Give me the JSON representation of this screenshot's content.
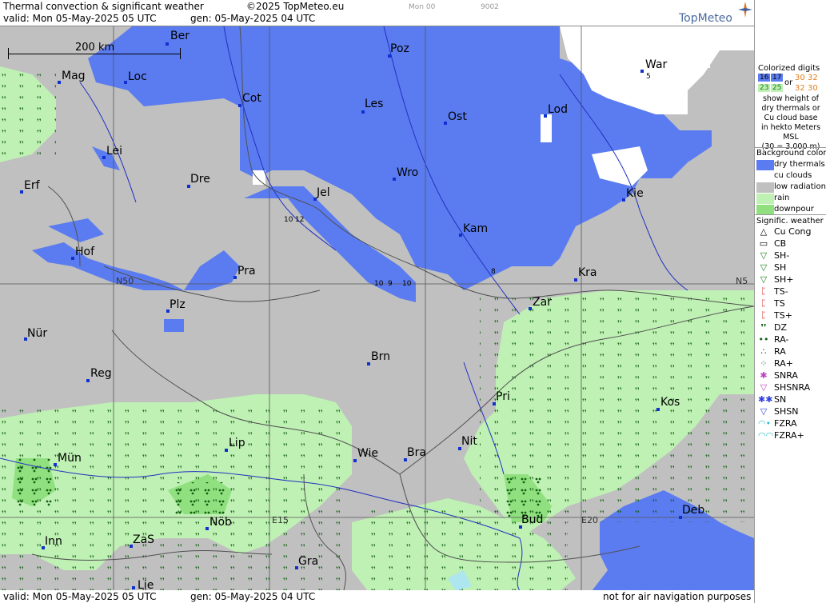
{
  "header": {
    "title": "Thermal convection & significant weather",
    "copyright": "©2025 TopMeteo.eu",
    "run_label": "Mon 00",
    "code": "9002",
    "valid": "valid:  Mon  05-May-2025  05 UTC",
    "gen": "gen: 05-May-2025 04 UTC",
    "logo": "TopMeteo"
  },
  "footer": {
    "valid": "valid:  Mon  05-May-2025  05 UTC",
    "gen": "gen: 05-May-2025 04 UTC",
    "note": "not for air navigation purposes"
  },
  "scale": {
    "label": "200 km"
  },
  "grid_labels": {
    "n50_left": "N50",
    "n50_right": "N5",
    "e15": "E15",
    "e20": "E20"
  },
  "cities": [
    {
      "name": "Ber"
    },
    {
      "name": "Poz"
    },
    {
      "name": "War"
    },
    {
      "name": "Mag"
    },
    {
      "name": "Loc"
    },
    {
      "name": "Cot"
    },
    {
      "name": "Les"
    },
    {
      "name": "Ost"
    },
    {
      "name": "Lod"
    },
    {
      "name": "Lei"
    },
    {
      "name": "Erf"
    },
    {
      "name": "Dre"
    },
    {
      "name": "Jel"
    },
    {
      "name": "Wro"
    },
    {
      "name": "Kie"
    },
    {
      "name": "Kam"
    },
    {
      "name": "Hof"
    },
    {
      "name": "Pra"
    },
    {
      "name": "Kra"
    },
    {
      "name": "Plz"
    },
    {
      "name": "Zar"
    },
    {
      "name": "Nür"
    },
    {
      "name": "Brn"
    },
    {
      "name": "Reg"
    },
    {
      "name": "Pri"
    },
    {
      "name": "Kos"
    },
    {
      "name": "Lip"
    },
    {
      "name": "Nit"
    },
    {
      "name": "Wie"
    },
    {
      "name": "Bra"
    },
    {
      "name": "Mün"
    },
    {
      "name": "Deb"
    },
    {
      "name": "Nöb"
    },
    {
      "name": "Bud"
    },
    {
      "name": "Inn"
    },
    {
      "name": "ZaS"
    },
    {
      "name": "Gra"
    },
    {
      "name": "Lie"
    }
  ],
  "map_numbers": {
    "n1": "10",
    "n2": "12",
    "n3": "10",
    "n4": "9",
    "n5": "10",
    "n6": "8",
    "n7": "5"
  },
  "legend": {
    "colorized_title": "Colorized digits",
    "d1": "16",
    "d2": "17",
    "d3": "30",
    "d4": "32",
    "d5": "32",
    "d6": "30",
    "d7": "23",
    "d8": "25",
    "or": "or",
    "desc": [
      "show height of",
      "dry thermals or",
      "Cu cloud base",
      "in hekto Meters",
      "MSL",
      "(30 = 3.000 m)"
    ],
    "bg_title": "Background color",
    "bg_items": [
      {
        "label": "dry thermals",
        "color": "#5b7cf0"
      },
      {
        "label": "cu clouds",
        "color": "#ffffff"
      },
      {
        "label": "low radiation",
        "color": "#c0c0c0"
      },
      {
        "label": "rain",
        "color": "#bff0b4"
      },
      {
        "label": "downpour",
        "color": "#90e080"
      }
    ],
    "sig_title": "Signific. weather",
    "sig_items": [
      {
        "label": "Cu Cong",
        "icon": "cu-cong-icon",
        "glyph": "△",
        "color": "#000"
      },
      {
        "label": "CB",
        "icon": "cb-icon",
        "glyph": "▭",
        "color": "#000"
      },
      {
        "label": "SH-",
        "icon": "shower-light-icon",
        "glyph": "▽",
        "color": "#208020"
      },
      {
        "label": "SH",
        "icon": "shower-icon",
        "glyph": "▽",
        "color": "#208020"
      },
      {
        "label": "SH+",
        "icon": "shower-heavy-icon",
        "glyph": "▽",
        "color": "#208020"
      },
      {
        "label": "TS-",
        "icon": "thunderstorm-light-icon",
        "glyph": "ᛈ",
        "color": "#d02020"
      },
      {
        "label": "TS",
        "icon": "thunderstorm-icon",
        "glyph": "ᛈ",
        "color": "#d02020"
      },
      {
        "label": "TS+",
        "icon": "thunderstorm-heavy-icon",
        "glyph": "ᛈ",
        "color": "#d02020"
      },
      {
        "label": "DZ",
        "icon": "drizzle-icon",
        "glyph": "❜❜",
        "color": "#106010"
      },
      {
        "label": "RA-",
        "icon": "rain-light-icon",
        "glyph": "••",
        "color": "#106010"
      },
      {
        "label": "RA",
        "icon": "rain-icon",
        "glyph": "∴",
        "color": "#106010"
      },
      {
        "label": "RA+",
        "icon": "rain-heavy-icon",
        "glyph": "⁘",
        "color": "#106010"
      },
      {
        "label": "SNRA",
        "icon": "snow-rain-icon",
        "glyph": "✱",
        "color": "#c040c0"
      },
      {
        "label": "SHSNRA",
        "icon": "shower-snow-rain-icon",
        "glyph": "▽",
        "color": "#c040c0"
      },
      {
        "label": "SN",
        "icon": "snow-icon",
        "glyph": "✱✱",
        "color": "#3040e0"
      },
      {
        "label": "SHSN",
        "icon": "shower-snow-icon",
        "glyph": "▽",
        "color": "#3040e0"
      },
      {
        "label": "FZRA",
        "icon": "freezing-rain-icon",
        "glyph": "◠•",
        "color": "#30c0d0"
      },
      {
        "label": "FZRA+",
        "icon": "freezing-rain-heavy-icon",
        "glyph": "◠◠",
        "color": "#30c0d0"
      }
    ]
  }
}
